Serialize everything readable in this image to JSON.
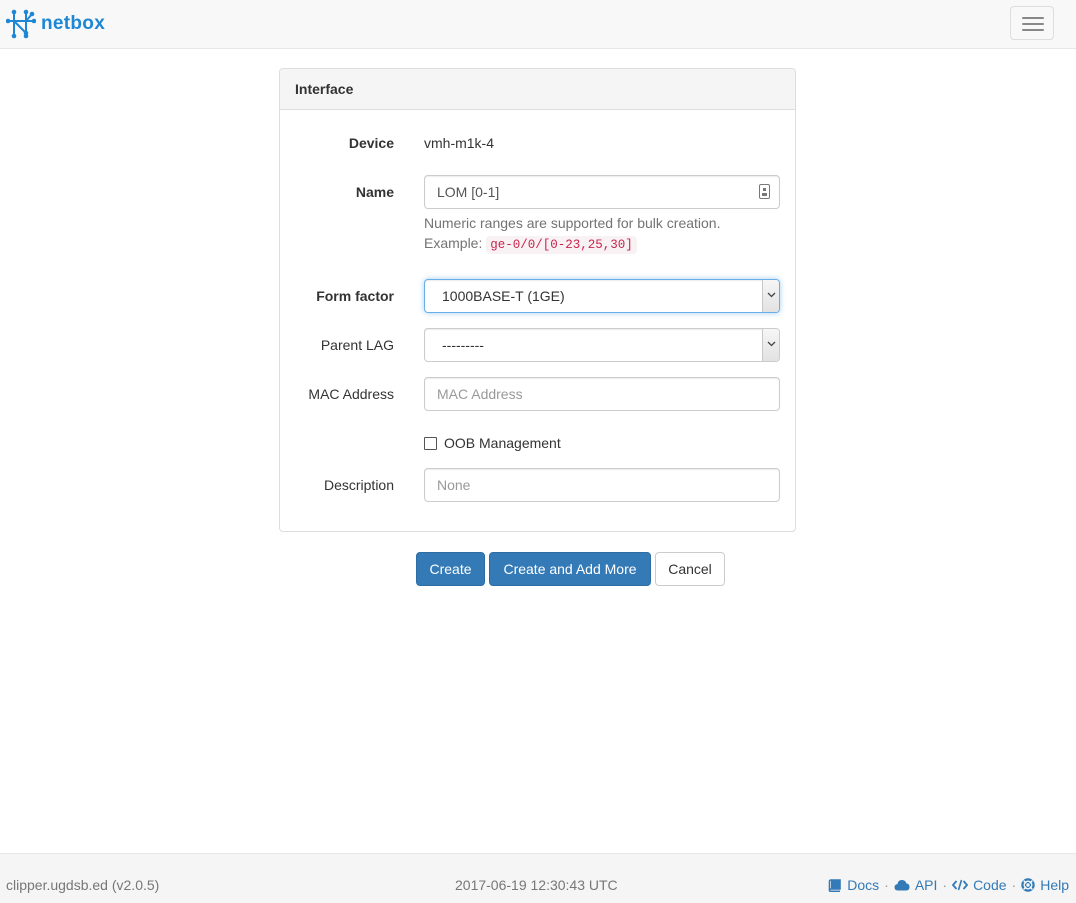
{
  "navbar": {
    "brand": "netbox",
    "menu_toggle": "toggle-navigation"
  },
  "panel": {
    "title": "Interface"
  },
  "form": {
    "device": {
      "label": "Device",
      "value": "vmh-m1k-4"
    },
    "name": {
      "label": "Name",
      "value": "LOM [0-1]",
      "help": "Numeric ranges are supported for bulk creation.",
      "help_example_label": "Example:",
      "help_example_code": "ge-0/0/[0-23,25,30]"
    },
    "form_factor": {
      "label": "Form factor",
      "value": "1000BASE-T (1GE)"
    },
    "parent_lag": {
      "label": "Parent LAG",
      "value": "---------"
    },
    "mac_address": {
      "label": "MAC Address",
      "value": "",
      "placeholder": "MAC Address"
    },
    "mgmt_only": {
      "label": "OOB Management",
      "checked": false
    },
    "description": {
      "label": "Description",
      "value": "",
      "placeholder": "None"
    }
  },
  "buttons": {
    "create": "Create",
    "create_add_more": "Create and Add More",
    "cancel": "Cancel"
  },
  "footer": {
    "host": "clipper.ugdsb.ed (v2.0.5)",
    "timestamp": "2017-06-19 12:30:43 UTC",
    "links": [
      {
        "label": "Docs",
        "icon": "book-icon"
      },
      {
        "label": "API",
        "icon": "cloud-icon"
      },
      {
        "label": "Code",
        "icon": "code-icon"
      },
      {
        "label": "Help",
        "icon": "life-ring-icon"
      }
    ],
    "separator": "·"
  },
  "colors": {
    "brand": "#1e87d4",
    "primary": "#337ab7",
    "link": "#337ab7",
    "code_text": "#c7254e",
    "focus_border": "#66afe9"
  }
}
